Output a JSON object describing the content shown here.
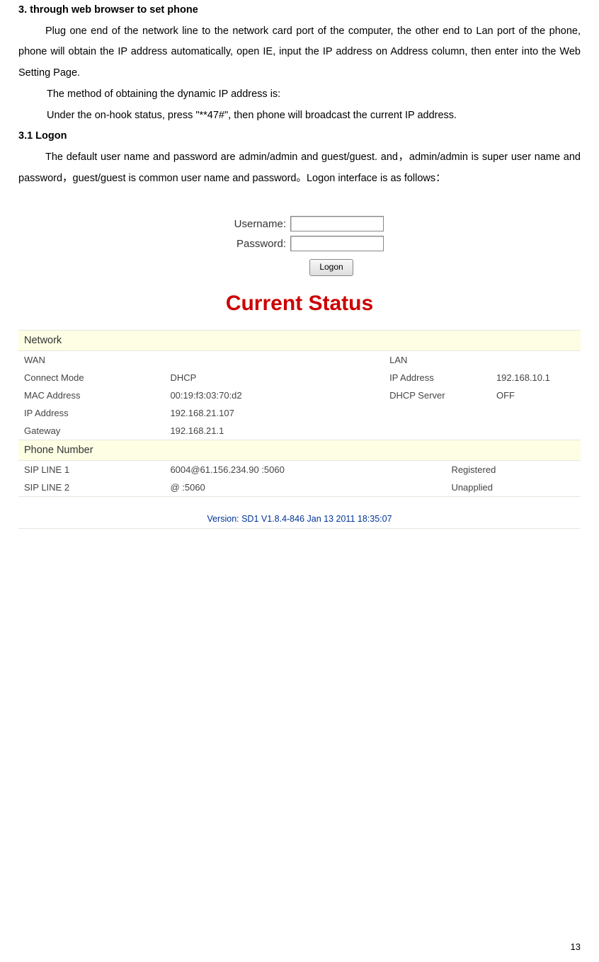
{
  "doc": {
    "h3": "3. through web browser to set phone",
    "p1": "Plug one end of the network line to the network card port of the computer, the other end to Lan port of the phone, phone will obtain the IP address automatically, open IE, input the IP address on Address column, then enter into the Web Setting Page.",
    "p2": "The method of obtaining the dynamic IP address is:",
    "p3": "Under the on-hook status, press \"**47#\", then phone will broadcast the current IP address.",
    "h31": "3.1 Logon",
    "p4": "The default user name and password are admin/admin and guest/guest. and，admin/admin is super user name and password，guest/guest is common user name and password。Logon interface is as follows：",
    "page_number": "13"
  },
  "login": {
    "username_label": "Username:",
    "password_label": "Password:",
    "button_label": "Logon"
  },
  "status": {
    "title": "Current Status",
    "network_label": "Network",
    "phone_label": "Phone Number",
    "net_rows": [
      {
        "a": "WAN",
        "b": "",
        "c": "LAN",
        "d": ""
      },
      {
        "a": "Connect Mode",
        "b": "DHCP",
        "c": "IP Address",
        "d": "192.168.10.1"
      },
      {
        "a": "MAC Address",
        "b": "00:19:f3:03:70:d2",
        "c": "DHCP Server",
        "d": "OFF"
      },
      {
        "a": "IP Address",
        "b": "192.168.21.107",
        "c": "",
        "d": ""
      },
      {
        "a": "Gateway",
        "b": "192.168.21.1",
        "c": "",
        "d": ""
      }
    ],
    "phone_rows": [
      {
        "a": "SIP LINE 1",
        "b": "6004@61.156.234.90 :5060",
        "c": "Registered"
      },
      {
        "a": "SIP LINE 2",
        "b": "@ :5060",
        "c": "Unapplied"
      }
    ],
    "version": "Version: SD1 V1.8.4-846 Jan 13 2011 18:35:07"
  }
}
